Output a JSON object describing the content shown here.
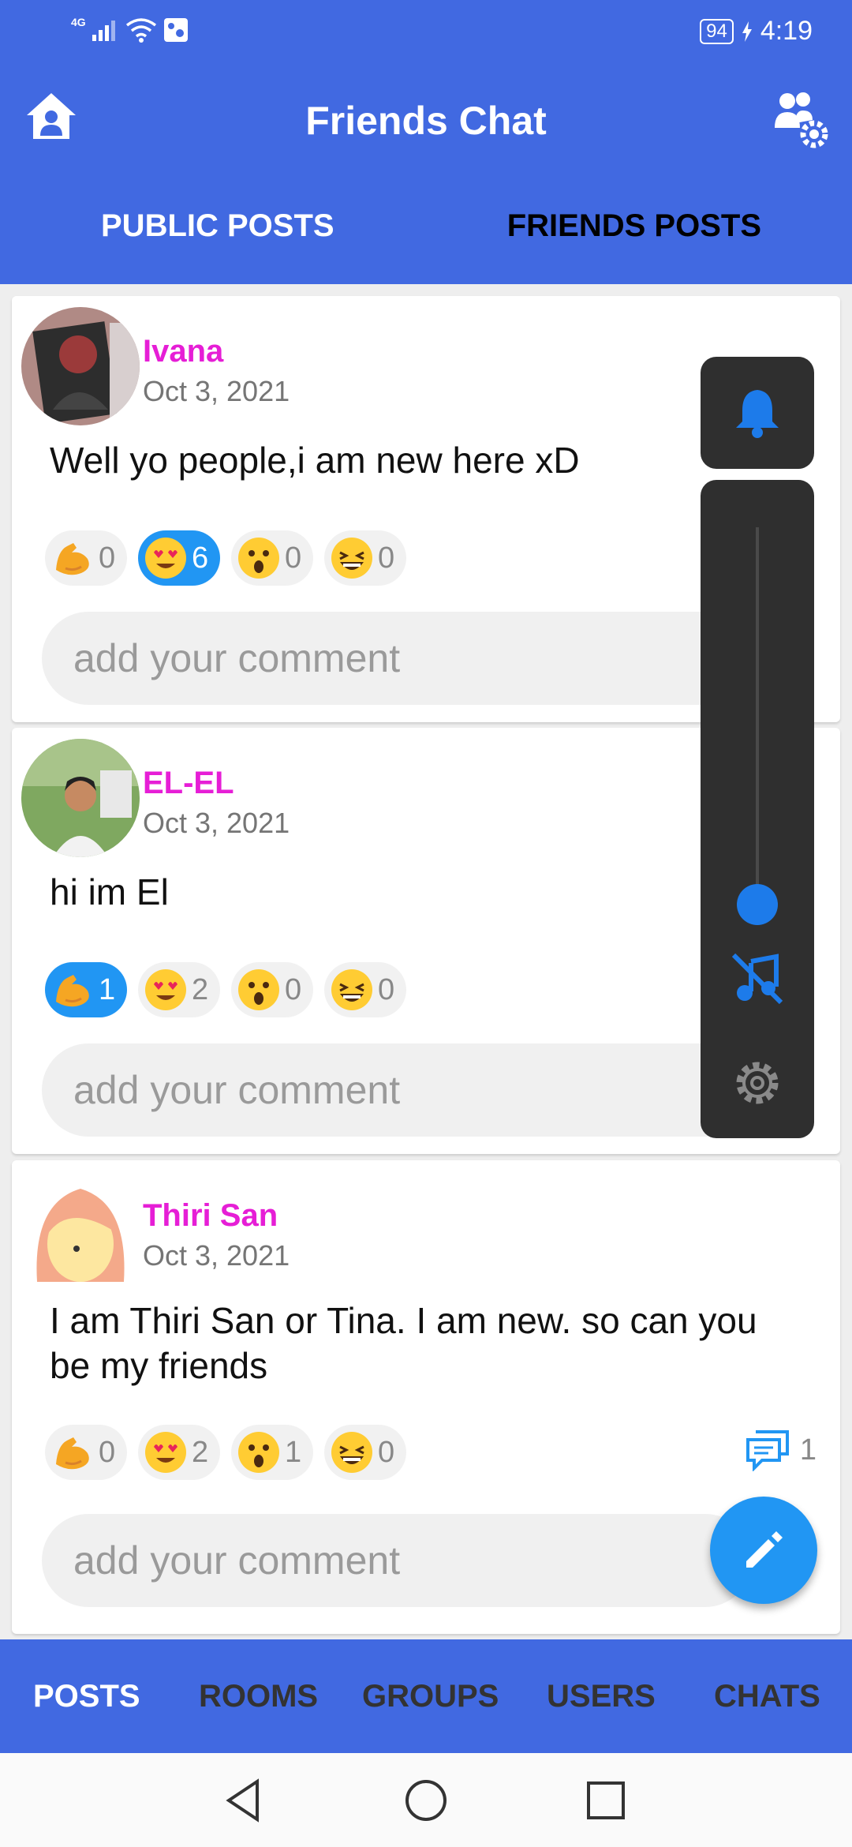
{
  "status_bar": {
    "network": "4G",
    "battery": "94",
    "time": "4:19"
  },
  "header": {
    "title": "Friends Chat",
    "home_icon": "home-icon",
    "settings_icon": "group-settings-icon"
  },
  "tabs": [
    {
      "label": "PUBLIC POSTS",
      "active": true
    },
    {
      "label": "FRIENDS POSTS",
      "active": false
    }
  ],
  "posts": [
    {
      "author": "Ivana",
      "date": "Oct 3, 2021",
      "text": "Well yo people,i am new here xD",
      "reactions": [
        {
          "icon": "flex-icon",
          "count": "0",
          "active": false
        },
        {
          "icon": "heart-eyes-icon",
          "count": "6",
          "active": true
        },
        {
          "icon": "surprised-icon",
          "count": "0",
          "active": false
        },
        {
          "icon": "laughing-icon",
          "count": "0",
          "active": false
        }
      ],
      "comment_placeholder": "add your comment"
    },
    {
      "author": "EL-EL",
      "date": "Oct 3, 2021",
      "text": "hi im El",
      "reactions": [
        {
          "icon": "flex-icon",
          "count": "1",
          "active": true
        },
        {
          "icon": "heart-eyes-icon",
          "count": "2",
          "active": false
        },
        {
          "icon": "surprised-icon",
          "count": "0",
          "active": false
        },
        {
          "icon": "laughing-icon",
          "count": "0",
          "active": false
        }
      ],
      "comment_placeholder": "add your comment"
    },
    {
      "author": "Thiri San",
      "date": "Oct 3, 2021",
      "text": "I am Thiri San or Tina. I am new. so can you be my friends",
      "reactions": [
        {
          "icon": "flex-icon",
          "count": "0",
          "active": false
        },
        {
          "icon": "heart-eyes-icon",
          "count": "2",
          "active": false
        },
        {
          "icon": "surprised-icon",
          "count": "1",
          "active": false
        },
        {
          "icon": "laughing-icon",
          "count": "0",
          "active": false
        }
      ],
      "comments_count": "1",
      "comment_placeholder": "add your comment"
    }
  ],
  "volume_panel": {
    "level": 0.05,
    "bell_icon": "bell-icon",
    "music_off_icon": "music-off-icon",
    "settings_icon": "gear-icon"
  },
  "fab": {
    "icon": "pencil-icon"
  },
  "bottom_nav": [
    {
      "label": "POSTS",
      "active": true
    },
    {
      "label": "ROOMS",
      "active": false
    },
    {
      "label": "GROUPS",
      "active": false
    },
    {
      "label": "USERS",
      "active": false
    },
    {
      "label": "CHATS",
      "active": false
    }
  ],
  "colors": {
    "primary": "#4169E1",
    "accent": "#2196F3",
    "author": "#E61ED6",
    "panel": "#2f2f2f"
  }
}
